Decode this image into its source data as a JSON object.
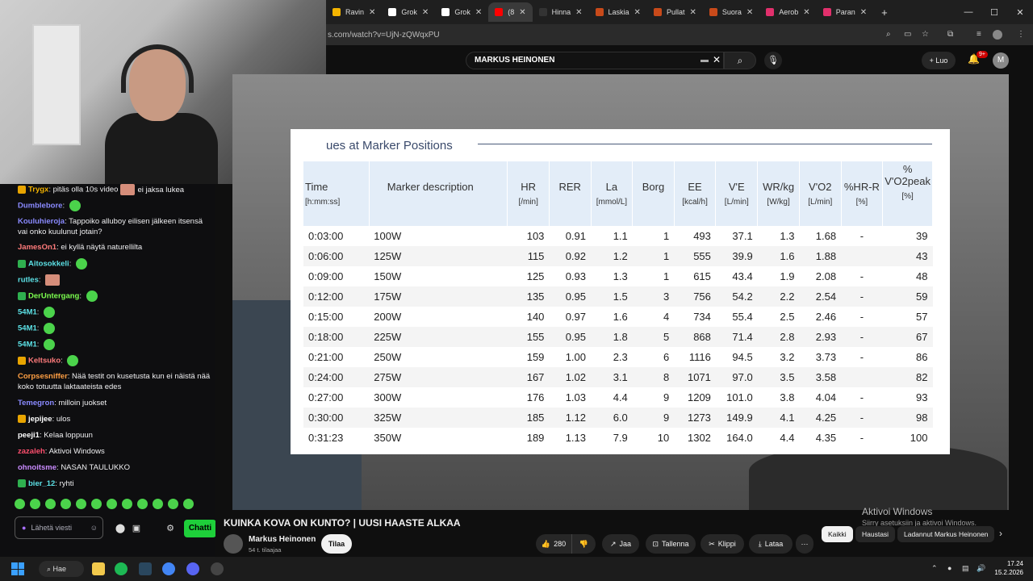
{
  "browser": {
    "tabs": [
      {
        "label": "Ravin",
        "color": "#f4b400"
      },
      {
        "label": "Grok",
        "color": "#ffffff"
      },
      {
        "label": "Grok",
        "color": "#ffffff"
      },
      {
        "label": "(8",
        "color": "#ff0000",
        "active": true
      },
      {
        "label": "Hinna",
        "color": "#333333"
      },
      {
        "label": "Laskia",
        "color": "#c84a1a"
      },
      {
        "label": "Pullat",
        "color": "#c84a1a"
      },
      {
        "label": "Suora",
        "color": "#c84a1a"
      },
      {
        "label": "Aerob",
        "color": "#e1306c"
      },
      {
        "label": "Paran",
        "color": "#e1306c"
      }
    ],
    "url": "s.com/watch?v=UjN-zQWqxPU"
  },
  "youtube": {
    "search_query": "MARKUS HEINONEN",
    "create_label": "Luo",
    "notif_count": "9+",
    "avatar_letter": "M",
    "video_title": "KUINKA KOVA ON KUNTO? | UUSI HAASTE ALKAA",
    "channel_name": "Markus Heinonen",
    "channel_subs": "54 t. tilaajaa",
    "subscribe_label": "Tilaa",
    "like_count": "280",
    "share_label": "Jaa",
    "save_label": "Tallenna",
    "clip_label": "Klippi",
    "download_label": "Lataa",
    "chips": [
      "Kaikki",
      "Haustasi",
      "Ladannut Markus Heinonen"
    ],
    "watermark_title": "Aktivoi Windows",
    "watermark_sub": "Siirry asetuksiin ja aktivoi Windows."
  },
  "table": {
    "title": "ues at Marker Positions",
    "headers": [
      {
        "name": "Time",
        "unit": "[h:mm:ss]"
      },
      {
        "name": "Marker description",
        "unit": ""
      },
      {
        "name": "HR",
        "unit": "[/min]"
      },
      {
        "name": "RER",
        "unit": ""
      },
      {
        "name": "La",
        "unit": "[mmol/L]"
      },
      {
        "name": "Borg",
        "unit": ""
      },
      {
        "name": "EE",
        "unit": "[kcal/h]"
      },
      {
        "name": "V'E",
        "unit": "[L/min]"
      },
      {
        "name": "WR/kg",
        "unit": "[W/kg]"
      },
      {
        "name": "V'O2",
        "unit": "[L/min]"
      },
      {
        "name": "%HR-R",
        "unit": "[%]"
      },
      {
        "name": "% V'O2peak",
        "unit": "[%]"
      }
    ],
    "rows": [
      [
        "0:03:00",
        "100W",
        "103",
        "0.91",
        "1.1",
        "1",
        "493",
        "37.1",
        "1.3",
        "1.68",
        "-",
        "39"
      ],
      [
        "0:06:00",
        "125W",
        "115",
        "0.92",
        "1.2",
        "1",
        "555",
        "39.9",
        "1.6",
        "1.88",
        "",
        "43"
      ],
      [
        "0:09:00",
        "150W",
        "125",
        "0.93",
        "1.3",
        "1",
        "615",
        "43.4",
        "1.9",
        "2.08",
        "-",
        "48"
      ],
      [
        "0:12:00",
        "175W",
        "135",
        "0.95",
        "1.5",
        "3",
        "756",
        "54.2",
        "2.2",
        "2.54",
        "-",
        "59"
      ],
      [
        "0:15:00",
        "200W",
        "140",
        "0.97",
        "1.6",
        "4",
        "734",
        "55.4",
        "2.5",
        "2.46",
        "-",
        "57"
      ],
      [
        "0:18:00",
        "225W",
        "155",
        "0.95",
        "1.8",
        "5",
        "868",
        "71.4",
        "2.8",
        "2.93",
        "-",
        "67"
      ],
      [
        "0:21:00",
        "250W",
        "159",
        "1.00",
        "2.3",
        "6",
        "1116",
        "94.5",
        "3.2",
        "3.73",
        "-",
        "86"
      ],
      [
        "0:24:00",
        "275W",
        "167",
        "1.02",
        "3.1",
        "8",
        "1071",
        "97.0",
        "3.5",
        "3.58",
        "",
        "82"
      ],
      [
        "0:27:00",
        "300W",
        "176",
        "1.03",
        "4.4",
        "9",
        "1209",
        "101.0",
        "3.8",
        "4.04",
        "-",
        "93"
      ],
      [
        "0:30:00",
        "325W",
        "185",
        "1.12",
        "6.0",
        "9",
        "1273",
        "149.9",
        "4.1",
        "4.25",
        "-",
        "98"
      ],
      [
        "0:31:23",
        "350W",
        "189",
        "1.13",
        "7.9",
        "10",
        "1302",
        "164.0",
        "4.4",
        "4.35",
        "-",
        "100"
      ]
    ]
  },
  "chat": {
    "messages": [
      {
        "user": "Trygx",
        "color": "#f4b400",
        "text": "pitäs olla 10s video",
        "after": "ei jaksa lukea",
        "badge": "gold"
      },
      {
        "user": "Dumblebore",
        "color": "#8a8aff",
        "text": ""
      },
      {
        "user": "Kouluhieroja",
        "color": "#8a8aff",
        "text": "Tappoiko alluboy eilisen jälkeen itsensä vai onko kuulunut jotain?"
      },
      {
        "user": "JamesOn1",
        "color": "#ff7b7b",
        "text": "ei kyllä näytä naturellilta"
      },
      {
        "user": "Aitosokkeli",
        "color": "#5ce1e6",
        "text": "",
        "badge": "green"
      },
      {
        "user": "rutles",
        "color": "#5ce1e6",
        "text": ""
      },
      {
        "user": "DerUntergang",
        "color": "#7cff4f",
        "text": "",
        "badge": "green"
      },
      {
        "user": "54M1",
        "color": "#5ce1e6",
        "text": ""
      },
      {
        "user": "54M1",
        "color": "#5ce1e6",
        "text": ""
      },
      {
        "user": "54M1",
        "color": "#5ce1e6",
        "text": ""
      },
      {
        "user": "Keltsuko",
        "color": "#ff7b7b",
        "text": "",
        "badge": "gold"
      },
      {
        "user": "Corpsesniffer",
        "color": "#ff9f43",
        "text": "Nää testit on kusetusta kun ei näistä nää koko totuutta laktaateista edes"
      },
      {
        "user": "Temegron",
        "color": "#8a8aff",
        "text": "milloin juokset"
      },
      {
        "user": "jepijee",
        "color": "#ffffff",
        "text": "ulos",
        "badge": "gold"
      },
      {
        "user": "peeji1",
        "color": "#ffffff",
        "text": "Kelaa loppuun"
      },
      {
        "user": "zazaleh",
        "color": "#ff4f6e",
        "text": "Aktivoi Windows"
      },
      {
        "user": "ohnoitsme",
        "color": "#c98bff",
        "text": "NASAN TAULUKKO"
      },
      {
        "user": "bier_12",
        "color": "#5ce1e6",
        "text": "ryhti",
        "badge": "green"
      }
    ],
    "input_placeholder": "Lähetä viesti",
    "chat_button": "Chatti"
  },
  "taskbar": {
    "search_label": "Hae",
    "time": "17.24",
    "date": "15.2.2026"
  }
}
